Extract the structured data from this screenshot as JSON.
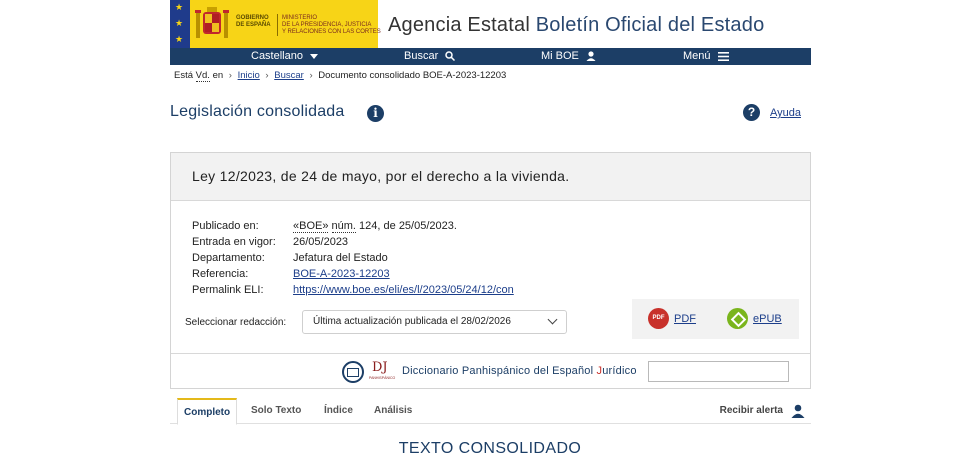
{
  "header": {
    "gov_line1": "GOBIERNO",
    "gov_line2": "DE ESPAÑA",
    "ministry_line1": "MINISTERIO",
    "ministry_line2": "DE LA PRESIDENCIA, JUSTICIA",
    "ministry_line3": "Y RELACIONES CON LAS CORTES",
    "title_prefix": "Agencia Estatal ",
    "title_boe": "Boletín Oficial del Estado"
  },
  "nav": {
    "language": "Castellano",
    "search": "Buscar",
    "my_boe": "Mi BOE",
    "menu": "Menú"
  },
  "breadcrumb": {
    "prefix": "Está",
    "vd": "Vd.",
    "en": "en",
    "home": "Inicio",
    "search": "Buscar",
    "current": "Documento consolidado BOE-A-2023-12203"
  },
  "section": {
    "title": "Legislación consolidada",
    "help": "Ayuda"
  },
  "document": {
    "title": "Ley 12/2023, de 24 de mayo, por el derecho a la vivienda.",
    "published_label": "Publicado en:",
    "published_boe": "«BOE»",
    "published_num": "núm.",
    "published_rest": " 124, de 25/05/2023.",
    "entry_label": "Entrada en vigor:",
    "entry_value": "26/05/2023",
    "dept_label": "Departamento:",
    "dept_value": "Jefatura del Estado",
    "ref_label": "Referencia:",
    "ref_value": "BOE-A-2023-12203",
    "eli_label": "Permalink ELI:",
    "eli_value": "https://www.boe.es/eli/es/l/2023/05/24/12/con",
    "select_label": "Seleccionar redacción:",
    "select_value": "Última actualización publicada el 28/02/2026",
    "pdf": "PDF",
    "pdf_icon": "PDF",
    "epub": "ePUB"
  },
  "dictionary": {
    "logo_letters": "DJ",
    "logo_small": "PANHISPÁNICO",
    "text_before": "Diccionario Panhispánico del Español ",
    "text_red": "J",
    "text_after": "urídico"
  },
  "tabs": {
    "complete": "Completo",
    "text_only": "Solo Texto",
    "index": "Índice",
    "analysis": "Análisis",
    "alert": "Recibir alerta"
  },
  "content": {
    "heading": "TEXTO CONSOLIDADO"
  },
  "colors": {
    "navy": "#1c3e66",
    "gov_yellow": "#f7d417",
    "link": "#1c3e8a",
    "pdf_red": "#c8312b",
    "epub_green": "#7ab51d",
    "tab_accent": "#e4b91a"
  }
}
